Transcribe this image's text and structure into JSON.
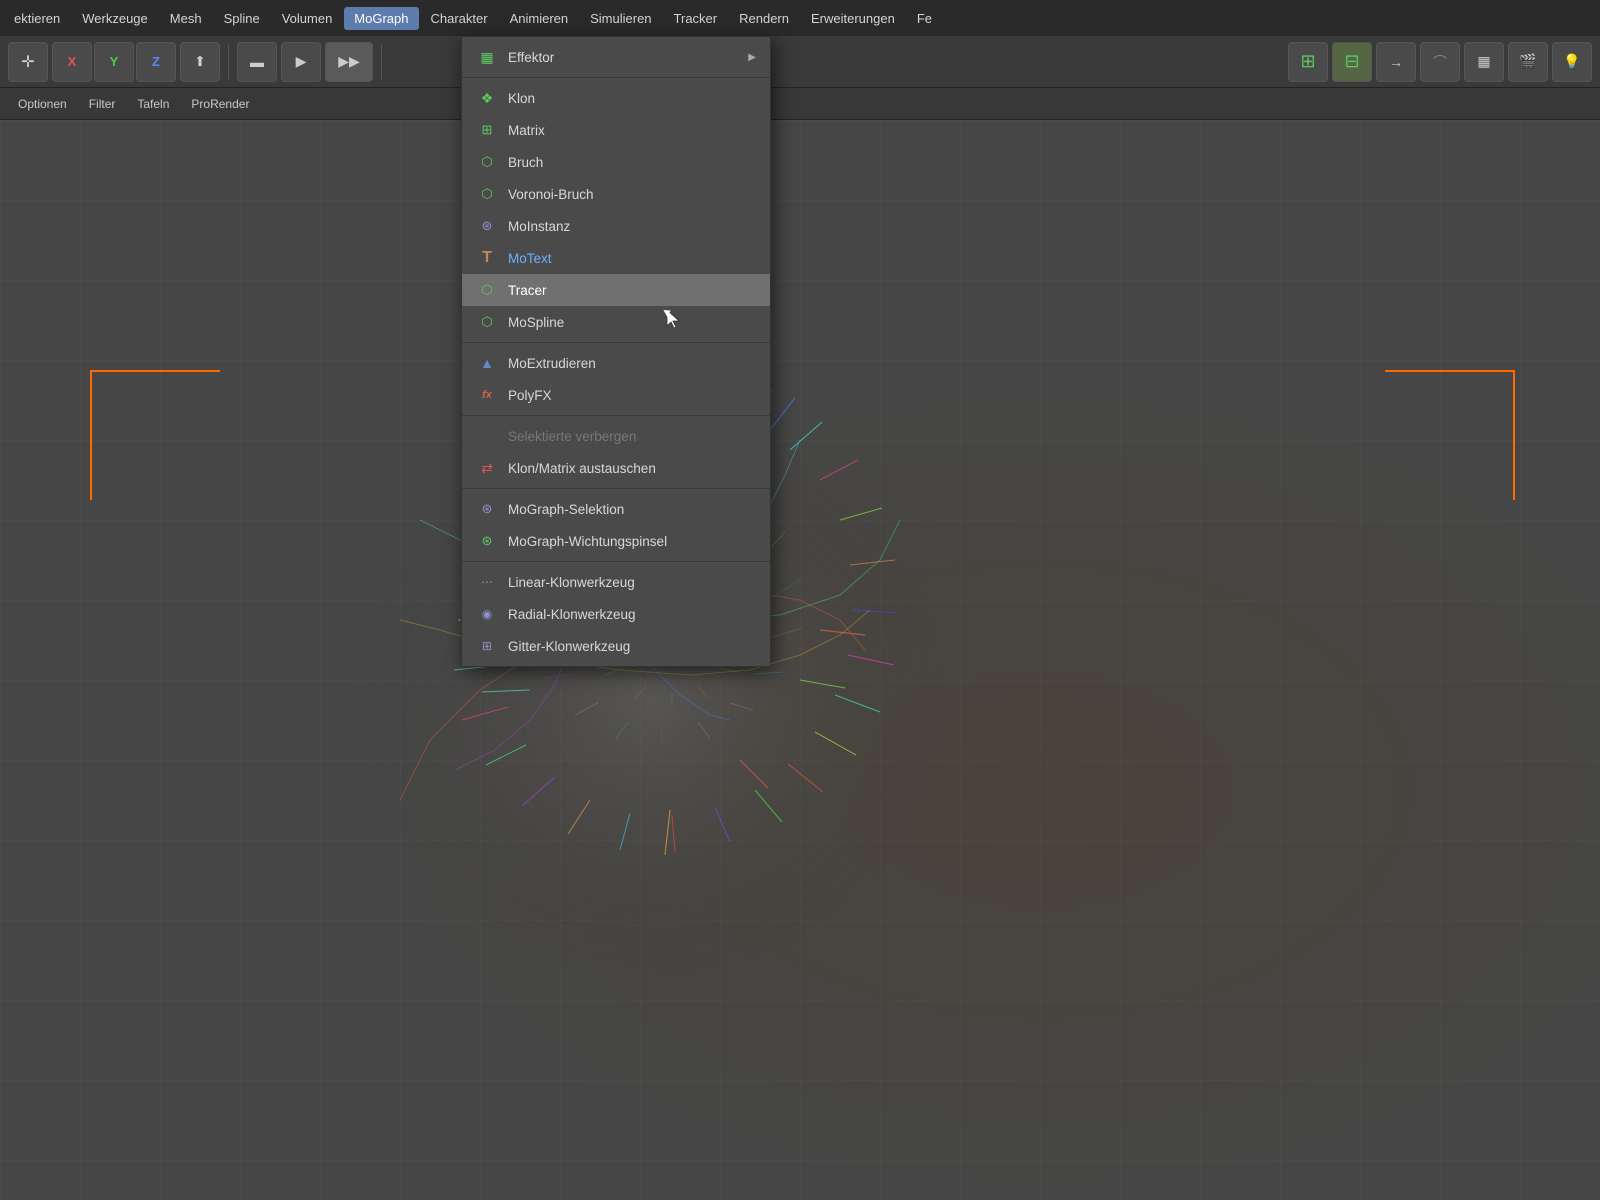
{
  "menubar": {
    "items": [
      {
        "label": "ektieren",
        "active": false
      },
      {
        "label": "Werkzeuge",
        "active": false
      },
      {
        "label": "Mesh",
        "active": false
      },
      {
        "label": "Spline",
        "active": false
      },
      {
        "label": "Volumen",
        "active": false
      },
      {
        "label": "MoGraph",
        "active": true
      },
      {
        "label": "Charakter",
        "active": false
      },
      {
        "label": "Animieren",
        "active": false
      },
      {
        "label": "Simulieren",
        "active": false
      },
      {
        "label": "Tracker",
        "active": false
      },
      {
        "label": "Rendern",
        "active": false
      },
      {
        "label": "Erweiterungen",
        "active": false
      },
      {
        "label": "Fe",
        "active": false
      }
    ]
  },
  "secondarybar": {
    "items": [
      {
        "label": "Optionen"
      },
      {
        "label": "Filter"
      },
      {
        "label": "Tafeln"
      },
      {
        "label": "ProRender"
      }
    ]
  },
  "dropdown": {
    "sections": [
      {
        "items": [
          {
            "id": "effektor",
            "label": "Effektor",
            "has_arrow": true,
            "icon": "▦",
            "icon_class": "icon-cloner"
          },
          {
            "separator": true
          },
          {
            "id": "klon",
            "label": "Klon",
            "icon": "❖",
            "icon_class": "icon-cloner"
          },
          {
            "id": "matrix",
            "label": "Matrix",
            "icon": "⊞",
            "icon_class": "icon-matrix"
          },
          {
            "id": "bruch",
            "label": "Bruch",
            "icon": "⬡",
            "icon_class": "icon-fracture"
          },
          {
            "id": "voronoi-bruch",
            "label": "Voronoi-Bruch",
            "icon": "⬡",
            "icon_class": "icon-voronoi"
          },
          {
            "id": "moinstanz",
            "label": "MoInstanz",
            "icon": "⊛",
            "icon_class": "icon-moinstanz"
          },
          {
            "id": "motext",
            "label": "MoText",
            "icon": "T",
            "icon_class": "icon-motext",
            "colored": true
          },
          {
            "id": "tracer",
            "label": "Tracer",
            "icon": "⬡",
            "icon_class": "icon-tracer",
            "highlighted": true
          },
          {
            "id": "mospline",
            "label": "MoSpline",
            "icon": "⬡",
            "icon_class": "icon-mospline"
          },
          {
            "separator": true
          },
          {
            "id": "moextrudieren",
            "label": "MoExtrudieren",
            "icon": "▲",
            "icon_class": "icon-moextrude"
          },
          {
            "id": "polyfx",
            "label": "PolyFX",
            "icon": "fx",
            "icon_class": "icon-polyfx"
          },
          {
            "separator": true
          },
          {
            "id": "selektierte-verbergen",
            "label": "Selektierte verbergen",
            "disabled": true
          },
          {
            "id": "klon-swap",
            "label": "Klon/Matrix austauschen",
            "icon": "⇄",
            "icon_class": "icon-klon-swap"
          },
          {
            "separator": true
          },
          {
            "id": "mograph-selektion",
            "label": "MoGraph-Selektion",
            "icon": "⊛",
            "icon_class": "icon-mograph-sel"
          },
          {
            "id": "mograph-wichtung",
            "label": "MoGraph-Wichtungspinsel",
            "icon": "⊛",
            "icon_class": "icon-mograph-paint"
          },
          {
            "separator": true
          },
          {
            "id": "linear-klon",
            "label": "Linear-Klonwerkzeug",
            "icon": "⋯",
            "icon_class": "icon-linear-klon"
          },
          {
            "id": "radial-klon",
            "label": "Radial-Klonwerkzeug",
            "icon": "◉",
            "icon_class": "icon-radial-klon"
          },
          {
            "id": "gitter-klon",
            "label": "Gitter-Klonwerkzeug",
            "icon": "⊞",
            "icon_class": "icon-grid-klon"
          }
        ]
      }
    ]
  }
}
